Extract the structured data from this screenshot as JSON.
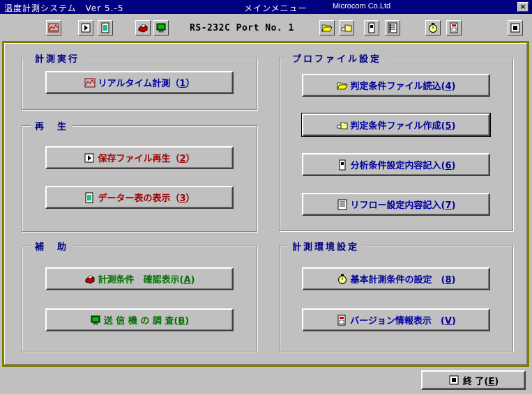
{
  "window": {
    "title": "温度計測システム　Ver 5.-5",
    "menu_title": "メインメニュー",
    "company": "Microcom Co.Ltd",
    "close_label": "×"
  },
  "toolbar": {
    "port_label": "RS-232C Port No. 1",
    "icons": [
      "graph-icon",
      "play-icon",
      "card-icon",
      "printer-icon",
      "monitor-icon",
      "folder-open-icon",
      "hand-folder-icon",
      "document-icon",
      "report-icon",
      "stopwatch-icon",
      "version-icon",
      "stop-icon"
    ]
  },
  "groups": {
    "measure": {
      "label": "計測実行"
    },
    "replay": {
      "label": "再　生"
    },
    "assist": {
      "label": "補　助"
    },
    "profile": {
      "label": "プロファイル設定"
    },
    "env": {
      "label": "計測環境設定"
    }
  },
  "buttons": {
    "realtime": {
      "text": "リアルタイム計測（",
      "key": "1",
      "end": "）"
    },
    "replay_file": {
      "text": "保存ファイル再生（",
      "key": "2",
      "end": "）"
    },
    "data_table": {
      "text": "データー表の表示（",
      "key": "3",
      "end": "）"
    },
    "cond_confirm": {
      "text": "計測条件　確認表示(",
      "key": "A",
      "end": ")"
    },
    "transmitter": {
      "text": "送 信 機 の 調 査(",
      "key": "B",
      "end": ")"
    },
    "read_file": {
      "text": "判定条件ファイル読込(",
      "key": "4",
      "end": ")"
    },
    "create_file": {
      "text": "判定条件ファイル作成(",
      "key": "5",
      "end": ")"
    },
    "analysis_log": {
      "text": "分析条件設定内容記入(",
      "key": "6",
      "end": ")"
    },
    "reflow_log": {
      "text": "リフロー設定内容記入(",
      "key": "7",
      "end": ")"
    },
    "basic_settings": {
      "text": "基本計測条件の設定　(",
      "key": "8",
      "end": ")"
    },
    "version_info": {
      "text": "バージョン情報表示　(",
      "key": "V",
      "end": ")"
    }
  },
  "exit": {
    "text": "終 了(",
    "key": "E",
    "end": ")"
  },
  "colors": {
    "titlebar": "#000080",
    "face": "#c0c0c0",
    "frame": "#808000",
    "blue": "#0000a0",
    "red": "#a00000",
    "green": "#007000"
  }
}
